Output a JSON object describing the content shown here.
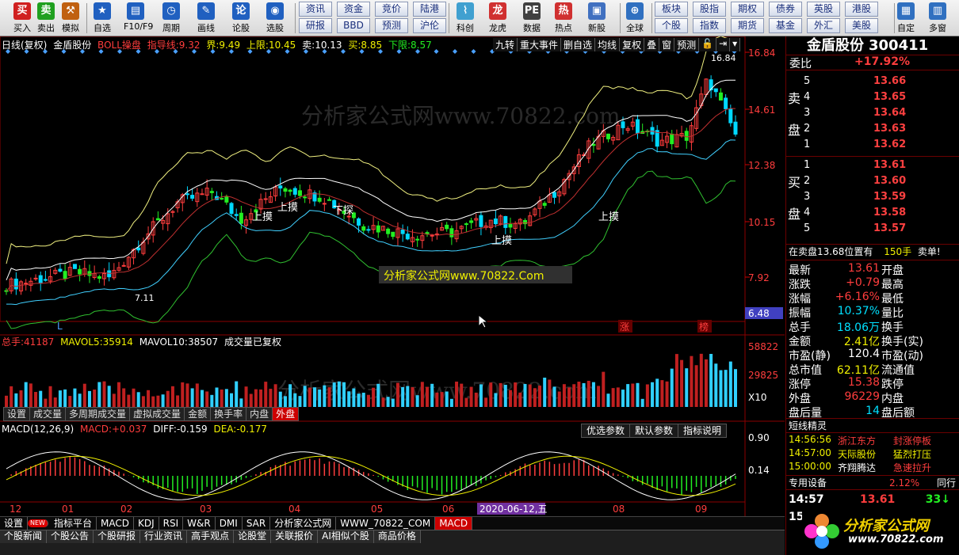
{
  "toolbar": {
    "buttons": [
      {
        "label": "买入",
        "glyph": "买"
      },
      {
        "label": "卖出",
        "glyph": "卖"
      },
      {
        "label": "模拟",
        "glyph": "⚒"
      },
      {
        "label": "自选",
        "glyph": "★"
      },
      {
        "label": "F10/F9",
        "glyph": "▤"
      },
      {
        "label": "周期",
        "glyph": "◷"
      },
      {
        "label": "画线",
        "glyph": "✎"
      },
      {
        "label": "论股",
        "glyph": "论"
      },
      {
        "label": "选股",
        "glyph": "◉"
      },
      {
        "label": "科创",
        "glyph": "⌇"
      },
      {
        "label": "龙虎",
        "glyph": "龙"
      },
      {
        "label": "数据",
        "glyph": "PE"
      },
      {
        "label": "热点",
        "glyph": "热"
      },
      {
        "label": "新股",
        "glyph": "▣"
      },
      {
        "label": "全球",
        "glyph": "⊕"
      },
      {
        "label": "自定",
        "glyph": "▦"
      },
      {
        "label": "多窗",
        "glyph": "▥"
      }
    ],
    "nav_top": [
      "资讯",
      "资金",
      "竞价",
      "陆港",
      "板块",
      "股指",
      "期权",
      "债券",
      "英股",
      "港股"
    ],
    "nav_bottom": [
      "研报",
      "BBD",
      "预测",
      "沪伦",
      "个股",
      "指数",
      "期货",
      "基金",
      "外汇",
      "美股"
    ]
  },
  "chart": {
    "title_left": "日线(复权)",
    "stock_name": "金盾股份",
    "indicator": "BOLL操盘",
    "guide_label": "指导线:",
    "guide_val": "9.32",
    "jie_label": "界:",
    "jie_val": "9.49",
    "upper_label": "上限:",
    "upper_val": "10.45",
    "sell_label": "卖:",
    "sell_val": "10.13",
    "buy_label": "买:",
    "buy_val": "8.85",
    "lower_label": "下限:",
    "lower_val": "8.57",
    "tools": [
      "九转",
      "重大事件",
      "删自选",
      "均线",
      "复权",
      "叠",
      "窗",
      "预测",
      "🔓",
      "⇥",
      "▾"
    ],
    "price_axis": [
      "16.84",
      "14.61",
      "12.38",
      "10.15",
      "7.92"
    ],
    "price_current": "6.48",
    "high_mark": "16.84",
    "low_mark": "7.11",
    "annotations": [
      "上摸",
      "上摸",
      "上摸",
      "上摸",
      "下探",
      "下探"
    ],
    "marker_l": "L",
    "marker_zhang": "涨",
    "marker_bang": "榜",
    "watermark": "分析家公式网www.70822.com",
    "watermark_center": "分析家公式网www.70822.Com",
    "date_hover": "2020-06-12,五",
    "x_axis": [
      "12",
      "01",
      "02",
      "03",
      "04",
      "05",
      "06",
      "08",
      "09"
    ]
  },
  "volume": {
    "total_label": "总手:",
    "total_val": "41187",
    "mavol5_label": "MAVOL5:",
    "mavol5_val": "35914",
    "mavol10_label": "MAVOL10:",
    "mavol10_val": "38507",
    "note": "成交量已复权",
    "axis": [
      "58822",
      "29825",
      "X10"
    ],
    "tabs": [
      "设置",
      "成交量",
      "多周期成交量",
      "虚拟成交量",
      "金额",
      "换手率",
      "内盘",
      "外盘"
    ],
    "active_tab": "外盘"
  },
  "macd": {
    "title": "MACD(12,26,9)",
    "macd_label": "MACD:",
    "macd_val": "+0.037",
    "diff_label": "DIFF:",
    "diff_val": "-0.159",
    "dea_label": "DEA:",
    "dea_val": "-0.177",
    "axis": [
      "0.90",
      "0.14"
    ],
    "options": [
      "优选参数",
      "默认参数",
      "指标说明"
    ]
  },
  "bottom_tabs": [
    "设置",
    "指标平台",
    "MACD",
    "KDJ",
    "RSI",
    "W&R",
    "DMI",
    "SAR",
    "分析家公式网",
    "WWW_70822_COM",
    "MACD"
  ],
  "bottom_new_badge": "NEW",
  "news_tabs": [
    "个股新闻",
    "个股公告",
    "个股研报",
    "行业资讯",
    "高手观点",
    "论股堂",
    "关联报价",
    "AI相似个股",
    "商品价格"
  ],
  "quote": {
    "name": "金盾股份",
    "code": "300411",
    "weibi_label": "委比",
    "weibi_val": "+17.92%",
    "sell_side": "卖盘",
    "buy_side": "买盘",
    "asks": [
      {
        "level": "5",
        "price": "13.66"
      },
      {
        "level": "4",
        "price": "13.65"
      },
      {
        "level": "3",
        "price": "13.64"
      },
      {
        "level": "2",
        "price": "13.63"
      },
      {
        "level": "1",
        "price": "13.62"
      }
    ],
    "bids": [
      {
        "level": "1",
        "price": "13.61"
      },
      {
        "level": "2",
        "price": "13.60"
      },
      {
        "level": "3",
        "price": "13.59"
      },
      {
        "level": "4",
        "price": "13.58"
      },
      {
        "level": "5",
        "price": "13.57"
      }
    ],
    "queue_text": "在卖盘13.68位置有",
    "queue_qty": "150手",
    "queue_action": "卖单!",
    "stats": [
      {
        "k1": "最新",
        "v1": "13.61",
        "k2": "开盘"
      },
      {
        "k1": "涨跌",
        "v1": "+0.79",
        "k2": "最高"
      },
      {
        "k1": "涨幅",
        "v1": "+6.16%",
        "k2": "最低"
      },
      {
        "k1": "振幅",
        "v1": "10.37%",
        "k2": "量比"
      },
      {
        "k1": "总手",
        "v1": "18.06万",
        "k2": "换手"
      },
      {
        "k1": "金额",
        "v1": "2.41亿",
        "k2": "换手(实)"
      },
      {
        "k1": "市盈(静)",
        "v1": "120.4",
        "k2": "市盈(动)"
      },
      {
        "k1": "总市值",
        "v1": "62.11亿",
        "k2": "流通值"
      },
      {
        "k1": "涨停",
        "v1": "15.38",
        "k2": "跌停"
      },
      {
        "k1": "外盘",
        "v1": "96229",
        "k2": "内盘"
      },
      {
        "k1": "盘后量",
        "v1": "14",
        "k2": "盘后额"
      }
    ],
    "short_title": "短线精灵",
    "short_items": [
      {
        "time": "14:56:56",
        "name": "浙江东方",
        "event": "封涨停板"
      },
      {
        "time": "14:57:00",
        "name": "天际股份",
        "event": "猛烈打压"
      },
      {
        "time": "15:00:00",
        "name": "齐翔腾达",
        "event": "急速拉升"
      }
    ],
    "special_label": "专用设备",
    "special_val": "2.12%",
    "special_tab": "同行",
    "ticks": [
      {
        "time": "14:57",
        "price": "13.61",
        "vol": "33",
        "dir": "↓"
      },
      {
        "time": "15:00",
        "price": "13.61",
        "vol": "3486",
        "dir": "↑"
      }
    ],
    "logo_text": "分析家公式网",
    "logo_url": "www.70822.com"
  },
  "colors": {
    "up": "#ff3d3d",
    "down": "#22ee22",
    "boll_mid": "#ffffff",
    "boll_up": "#f0f080",
    "boll_low": "#40d0ff",
    "guide": "#c03030"
  }
}
